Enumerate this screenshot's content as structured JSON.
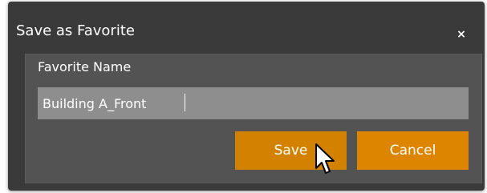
{
  "dialog": {
    "title": "Save as Favorite",
    "close_glyph": "×",
    "field_label": "Favorite Name",
    "name_value": "Building A_Front",
    "save_label": "Save",
    "cancel_label": "Cancel"
  },
  "colors": {
    "dialog_bg": "#3a3a3a",
    "panel_bg": "#535353",
    "input_bg": "#8e8e8e",
    "accent": "#dd8400"
  },
  "icons": {
    "close": "close-icon",
    "pointer": "mouse-pointer-icon"
  }
}
